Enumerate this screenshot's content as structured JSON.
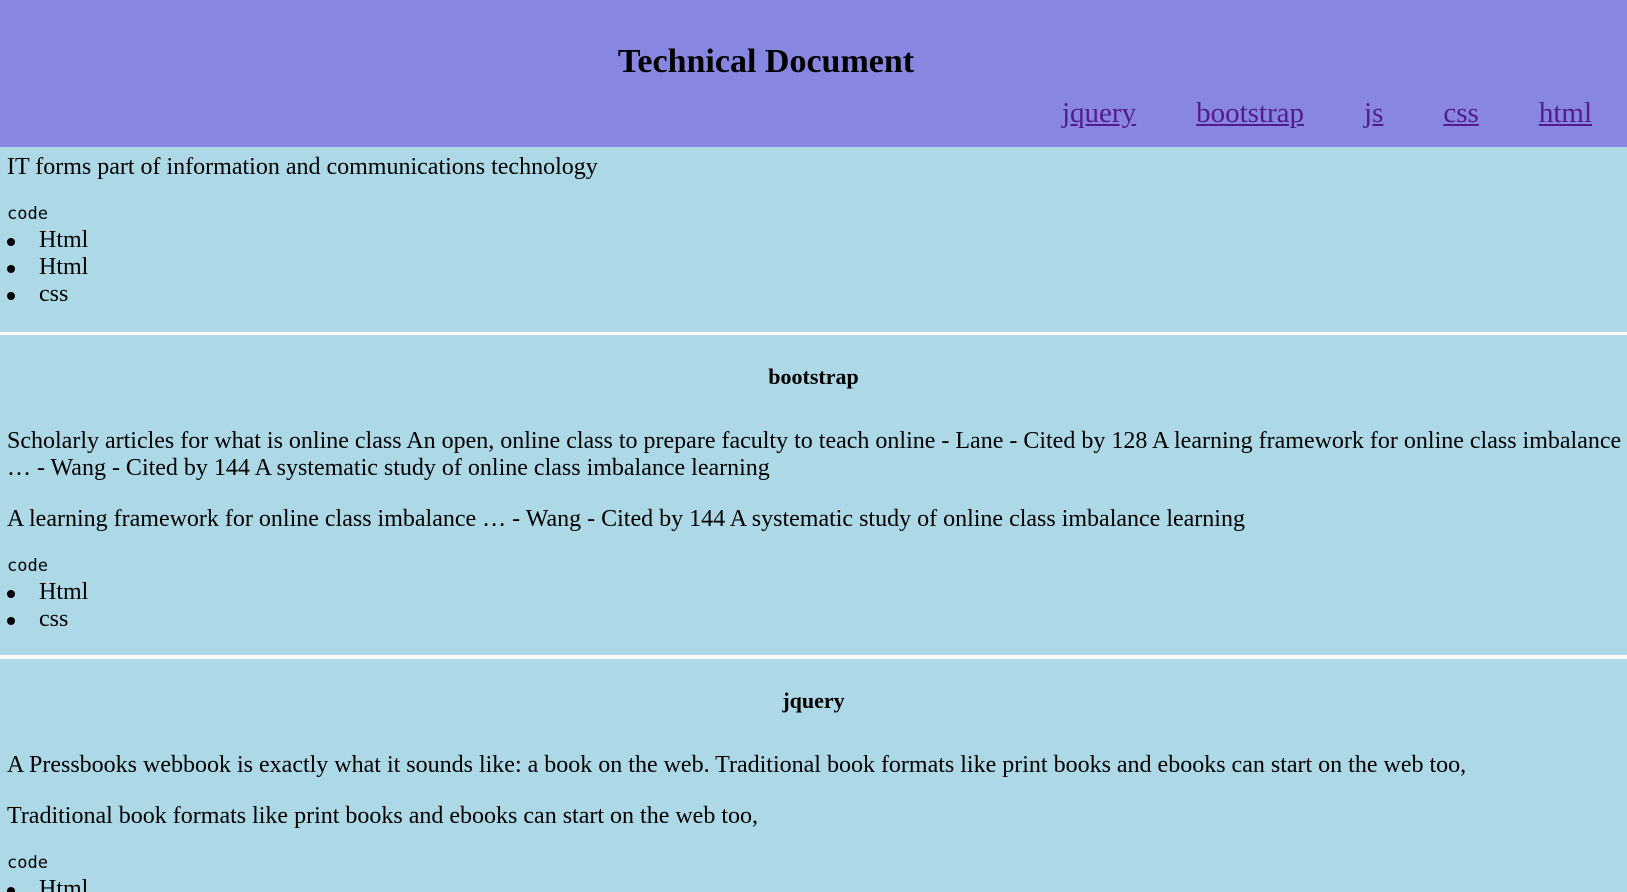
{
  "header": {
    "title": "Technical Document",
    "nav": [
      "jquery",
      "bootstrap",
      "js",
      "css",
      "html"
    ]
  },
  "intro": {
    "text": "IT forms part of information and communications technology",
    "code_label": "code",
    "items": [
      "Html",
      "Html",
      "css"
    ]
  },
  "bootstrap": {
    "heading": "bootstrap",
    "para1": "Scholarly articles for what is online class An open, online class to prepare faculty to teach online - Lane - Cited by 128 A learning framework for online class imbalance … - Wang - Cited by 144 A systematic study of online class imbalance learning",
    "para2": "A learning framework for online class imbalance … - Wang - Cited by 144 A systematic study of online class imbalance learning",
    "code_label": "code",
    "items": [
      "Html",
      "css"
    ]
  },
  "jquery": {
    "heading": "jquery",
    "para1": "A Pressbooks webbook is exactly what it sounds like: a book on the web. Traditional book formats like print books and ebooks can start on the web too,",
    "para2": "Traditional book formats like print books and ebooks can start on the web too,",
    "code_label": "code",
    "items": [
      "Html"
    ]
  },
  "colors": {
    "header_bg": "#8787e1",
    "section_bg": "#add8e6",
    "link": "#551a8b"
  }
}
